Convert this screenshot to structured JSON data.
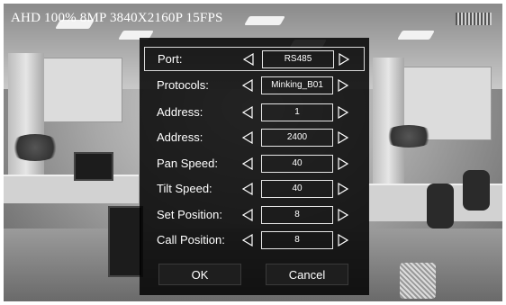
{
  "osd": {
    "title": "AHD 100% 8MP 3840X2160P 15FPS"
  },
  "menu": {
    "rows": [
      {
        "label": "Port:",
        "value": "RS485"
      },
      {
        "label": "Protocols:",
        "value": "Minking_B01"
      },
      {
        "label": "Address:",
        "value": "1"
      },
      {
        "label": "Address:",
        "value": "2400"
      },
      {
        "label": "Pan Speed:",
        "value": "40"
      },
      {
        "label": "Tilt Speed:",
        "value": "40"
      },
      {
        "label": "Set Position:",
        "value": "8"
      },
      {
        "label": "Call Position:",
        "value": "8"
      }
    ],
    "ok_label": "OK",
    "cancel_label": "Cancel"
  },
  "icons": {
    "left": "chevron-left-icon",
    "right": "chevron-right-icon"
  },
  "colors": {
    "menu_bg": "#000000",
    "text": "#ffffff"
  }
}
